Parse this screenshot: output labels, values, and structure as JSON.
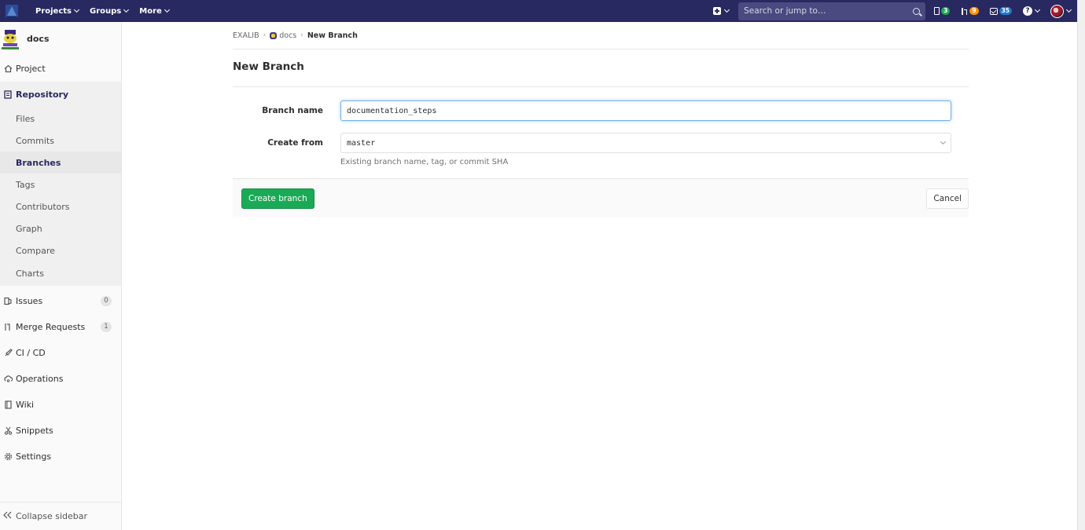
{
  "topbar": {
    "nav_projects": "Projects",
    "nav_groups": "Groups",
    "nav_more": "More",
    "search_placeholder": "Search or jump to…",
    "issues_count": "3",
    "mr_count": "9",
    "todos_count": "35",
    "colors": {
      "bar": "#292961",
      "issues_badge": "#1aaa55",
      "mr_badge": "#fc9403",
      "todos_badge": "#1f78d1"
    }
  },
  "sidebar": {
    "project_name": "docs",
    "project": "Project",
    "repository": "Repository",
    "repo_items": [
      "Files",
      "Commits",
      "Branches",
      "Tags",
      "Contributors",
      "Graph",
      "Compare",
      "Charts"
    ],
    "issues": "Issues",
    "issues_count": "0",
    "merge_requests": "Merge Requests",
    "merge_requests_count": "1",
    "cicd": "CI / CD",
    "operations": "Operations",
    "wiki": "Wiki",
    "snippets": "Snippets",
    "settings": "Settings",
    "collapse": "Collapse sidebar"
  },
  "breadcrumb": {
    "group": "EXALIB",
    "project": "docs",
    "current": "New Branch"
  },
  "page": {
    "title": "New Branch",
    "branch_name_label": "Branch name",
    "branch_name_value": "documentation_steps",
    "create_from_label": "Create from",
    "create_from_value": "master",
    "create_from_help": "Existing branch name, tag, or commit SHA",
    "create_button": "Create branch",
    "cancel_button": "Cancel"
  }
}
